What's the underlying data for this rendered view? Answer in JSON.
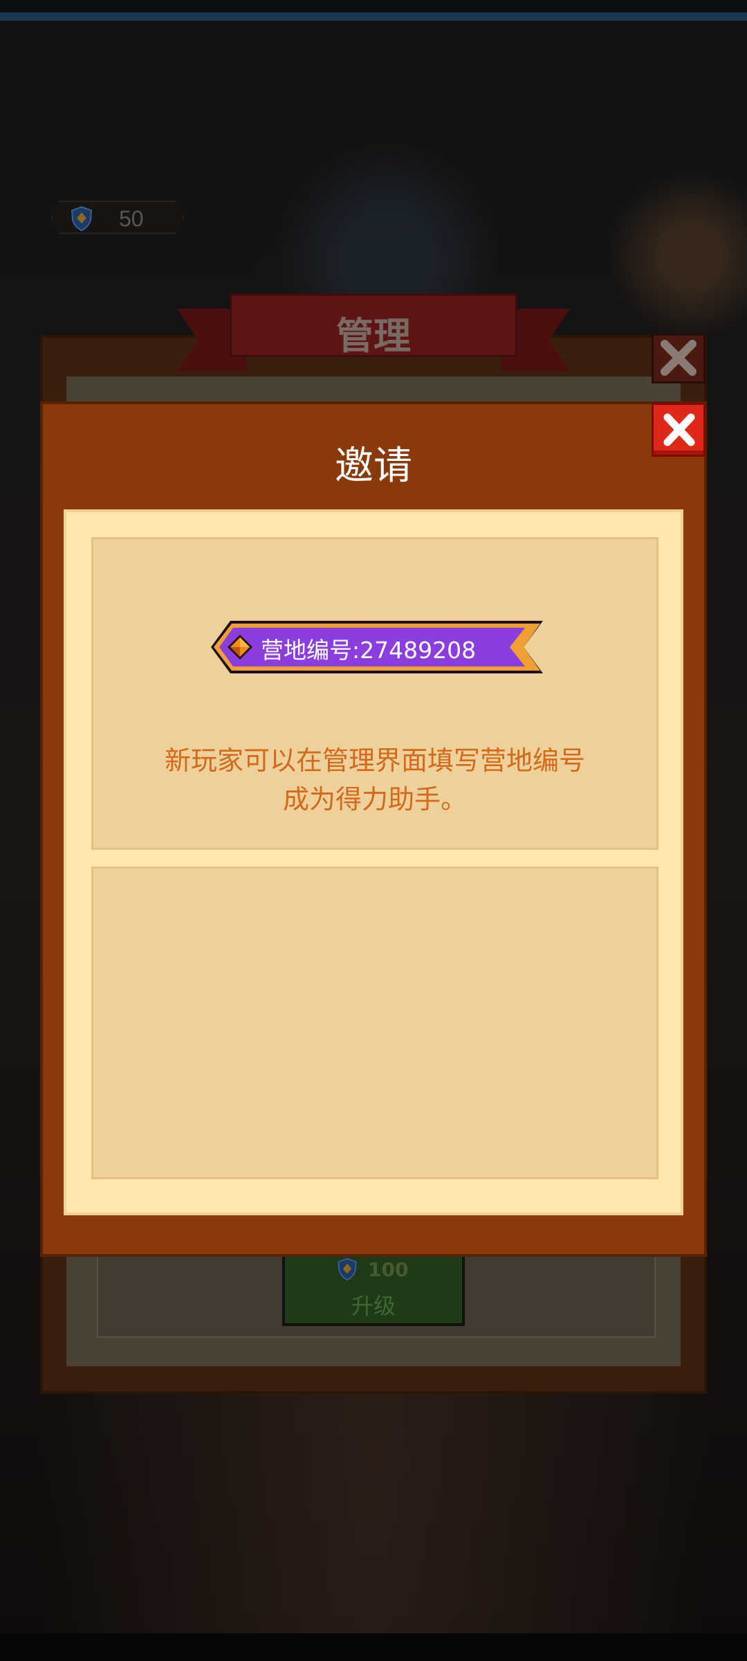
{
  "hud": {
    "currency_amount": "50"
  },
  "manage_panel": {
    "title": "管理",
    "upgrade_price": "100",
    "upgrade_label": "升级"
  },
  "invite_dialog": {
    "title": "邀请",
    "camp_id_text": "营地编号:27489208",
    "description_line1": "新玩家可以在管理界面填写营地编号",
    "description_line2": "成为得力助手。"
  },
  "colors": {
    "dialog_frame": "#8a3a0a",
    "paper": "#fde6b0",
    "banner_purple": "#8a3ee0",
    "description_text": "#d06a1c",
    "close_red": "#e02818"
  },
  "icons": {
    "currency": "shield-gem-icon",
    "camp_id": "diamond-gem-icon",
    "close": "close-x-icon"
  }
}
